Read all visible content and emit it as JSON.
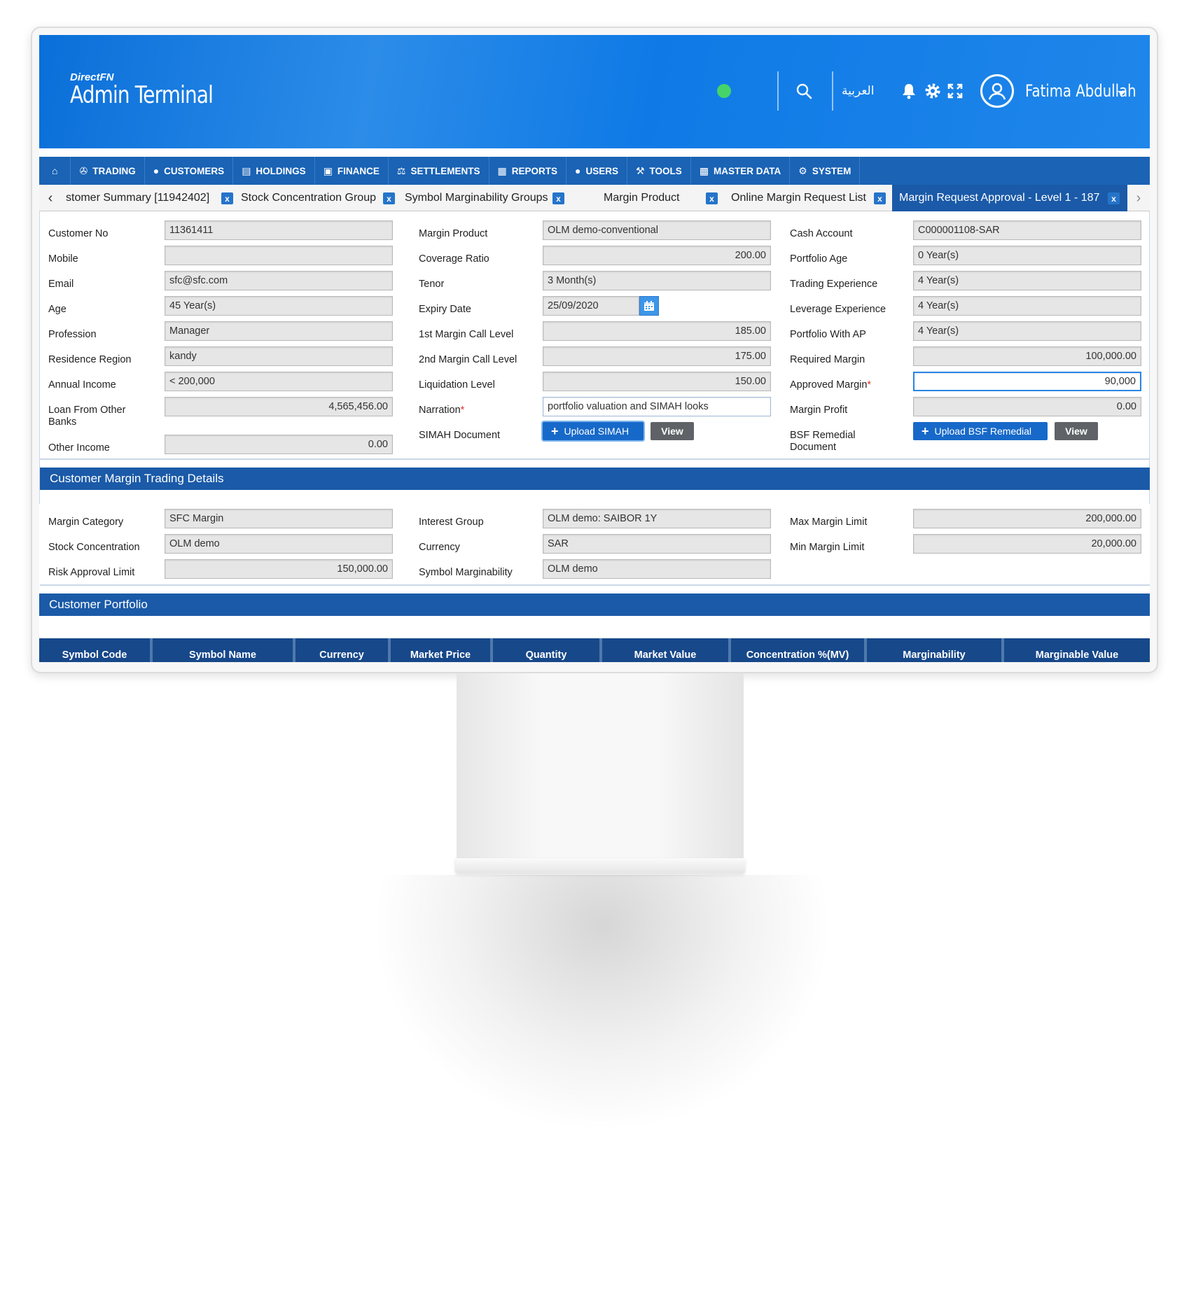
{
  "header": {
    "brand_small": "DirectFN",
    "brand_title": "Admin Terminal",
    "language_label": "العربية",
    "user_name": "Fatima Abdullah",
    "status_color": "#46d36a"
  },
  "menu": [
    {
      "label": "",
      "icon": "home-icon"
    },
    {
      "label": "TRADING",
      "icon": "handshake-icon"
    },
    {
      "label": "CUSTOMERS",
      "icon": "user-icon"
    },
    {
      "label": "HOLDINGS",
      "icon": "bar-chart-icon"
    },
    {
      "label": "FINANCE",
      "icon": "money-icon"
    },
    {
      "label": "SETTLEMENTS",
      "icon": "scale-icon"
    },
    {
      "label": "REPORTS",
      "icon": "document-icon"
    },
    {
      "label": "USERS",
      "icon": "user-icon"
    },
    {
      "label": "TOOLS",
      "icon": "wrench-icon"
    },
    {
      "label": "MASTER DATA",
      "icon": "puzzle-icon"
    },
    {
      "label": "SYSTEM",
      "icon": "gears-icon"
    }
  ],
  "tabs": [
    {
      "label": "stomer Summary [11942402]",
      "close": "x"
    },
    {
      "label": "Stock Concentration Group",
      "close": "x"
    },
    {
      "label": "Symbol Marginability Groups",
      "close": "x"
    },
    {
      "label": "Margin Product",
      "close": "x"
    },
    {
      "label": "Online Margin Request List",
      "close": "x"
    },
    {
      "label": "Margin Request Approval - Level 1 - 187",
      "close": "x",
      "active": true
    }
  ],
  "form": {
    "col1": [
      {
        "label": "Customer No",
        "value": "11361411"
      },
      {
        "label": "Mobile",
        "value": ""
      },
      {
        "label": "Email",
        "value": "sfc@sfc.com"
      },
      {
        "label": "Age",
        "value": "45 Year(s)"
      },
      {
        "label": "Profession",
        "value": "Manager"
      },
      {
        "label": "Residence Region",
        "value": "kandy"
      },
      {
        "label": "Annual Income",
        "value": "< 200,000"
      },
      {
        "label": "Loan From Other Banks",
        "value": "4,565,456.00"
      },
      {
        "label": "Other Income",
        "value": "0.00"
      }
    ],
    "col2": [
      {
        "label": "Margin Product",
        "value": "OLM demo-conventional"
      },
      {
        "label": "Coverage Ratio",
        "value": "200.00"
      },
      {
        "label": "Tenor",
        "value": "3 Month(s)"
      },
      {
        "label": "Expiry Date",
        "value": "25/09/2020"
      },
      {
        "label": "1st Margin Call Level",
        "value": "185.00"
      },
      {
        "label": "2nd Margin Call Level",
        "value": "175.00"
      },
      {
        "label": "Liquidation Level",
        "value": "150.00"
      },
      {
        "label": "Narration",
        "required": "*",
        "value": "portfolio valuation and SIMAH looks"
      },
      {
        "label": "SIMAH Document",
        "upload": "Upload SIMAH",
        "view": "View"
      }
    ],
    "col3": [
      {
        "label": "Cash Account",
        "value": "C000001108-SAR"
      },
      {
        "label": "Portfolio Age",
        "value": "0 Year(s)"
      },
      {
        "label": "Trading Experience",
        "value": "4 Year(s)"
      },
      {
        "label": "Leverage Experience",
        "value": "4 Year(s)"
      },
      {
        "label": "Portfolio With AP",
        "value": "4 Year(s)"
      },
      {
        "label": "Required Margin",
        "value": "100,000.00"
      },
      {
        "label": "Approved Margin",
        "required": "*",
        "value": "90,000"
      },
      {
        "label": "Margin Profit",
        "value": "0.00"
      },
      {
        "label": "BSF Remedial Document",
        "upload": "Upload BSF Remedial",
        "view": "View"
      }
    ]
  },
  "trading_details": {
    "title": "Customer Margin Trading Details",
    "col1": [
      {
        "label": "Margin Category",
        "value": "SFC Margin"
      },
      {
        "label": "Stock Concentration",
        "value": "OLM demo"
      },
      {
        "label": "Risk Approval Limit",
        "value": "150,000.00"
      }
    ],
    "col2": [
      {
        "label": "Interest Group",
        "value": "OLM demo: SAIBOR 1Y"
      },
      {
        "label": "Currency",
        "value": "SAR"
      },
      {
        "label": "Symbol Marginability",
        "value": "OLM demo"
      }
    ],
    "col3": [
      {
        "label": "Max Margin Limit",
        "value": "200,000.00"
      },
      {
        "label": "Min Margin Limit",
        "value": "20,000.00"
      }
    ]
  },
  "portfolio": {
    "title": "Customer Portfolio",
    "columns": [
      "Symbol Code",
      "Symbol Name",
      "Currency",
      "Market Price",
      "Quantity",
      "Market Value",
      "Concentration %(MV)",
      "Marginability",
      "Marginable Value"
    ]
  }
}
